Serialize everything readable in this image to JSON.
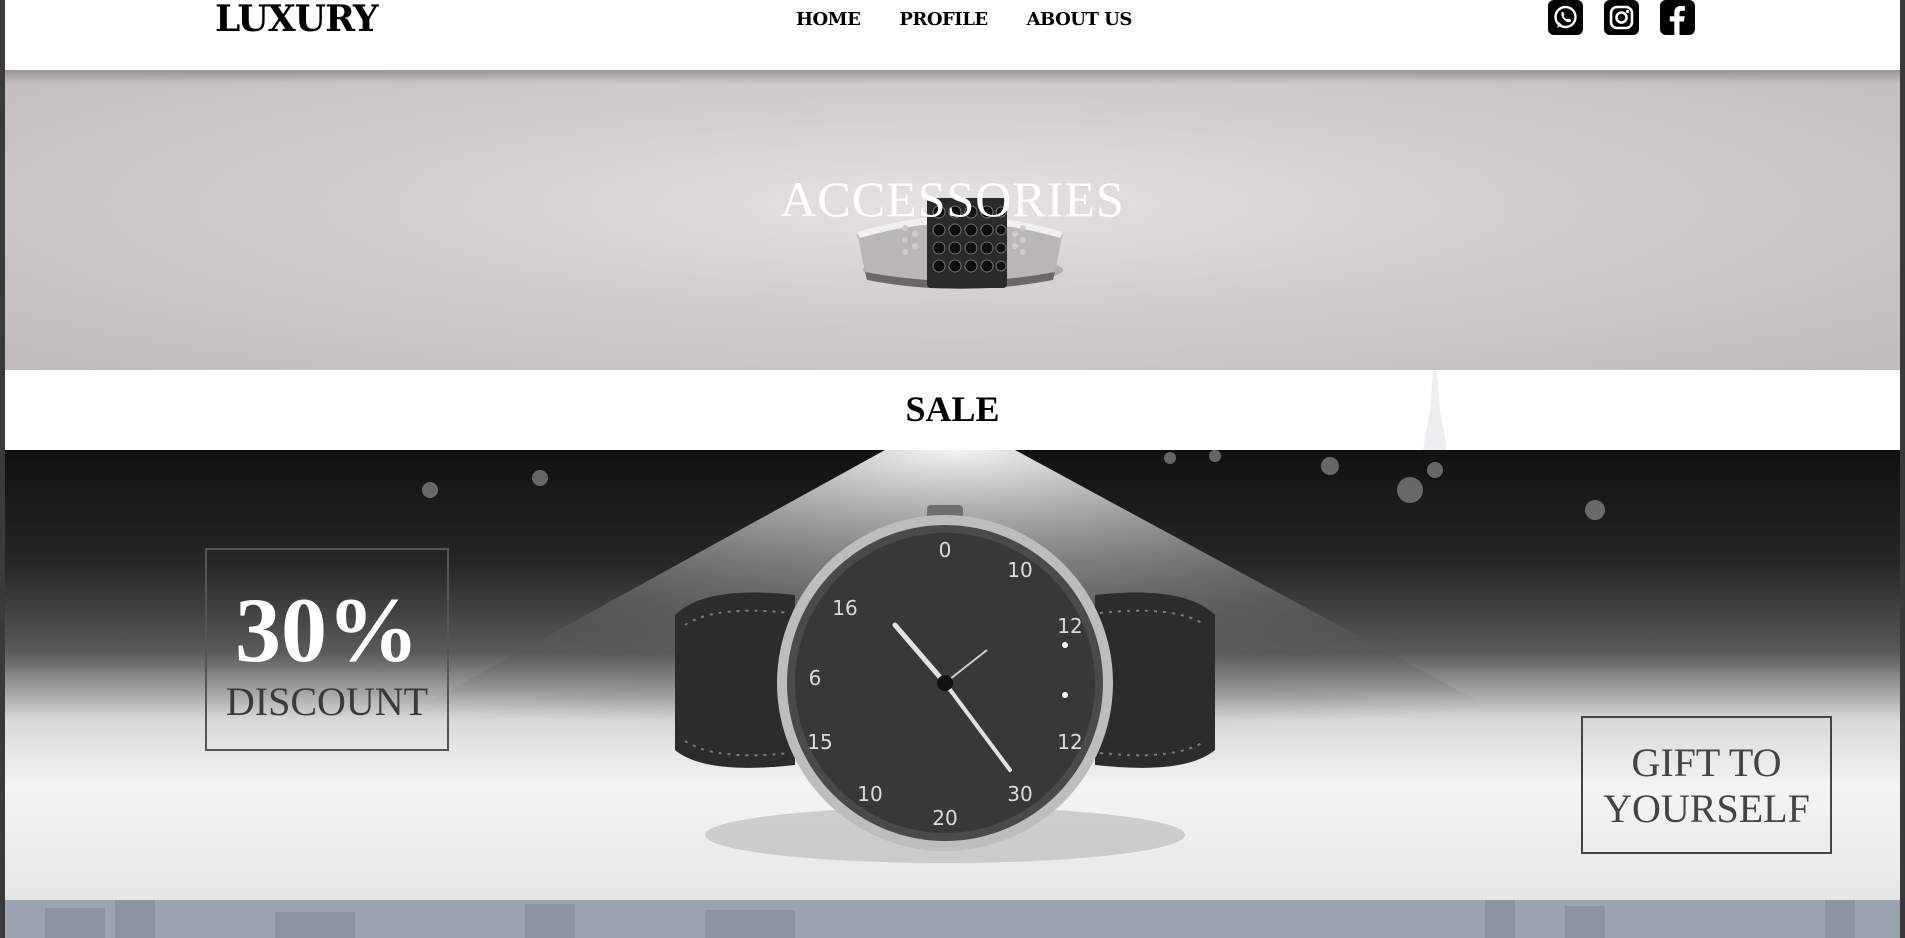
{
  "navbar": {
    "logo": "LUXURY",
    "links": [
      "HOME",
      "PROFILE",
      "ABOUT US"
    ],
    "social": [
      "whatsapp-icon",
      "instagram-icon",
      "facebook-icon"
    ]
  },
  "hero": {
    "title": "ACCESSORIES"
  },
  "sale": {
    "title": "SALE"
  },
  "promo": {
    "discount_value": "30%",
    "discount_label": "DISCOUNT",
    "gift_line1": "GIFT TO",
    "gift_line2": "YOURSELF"
  },
  "colors": {
    "nav_background": "#ffffff",
    "text_dark": "#000000",
    "hero_text": "#ffffff",
    "bottom_strip": "#9ba4b0"
  }
}
